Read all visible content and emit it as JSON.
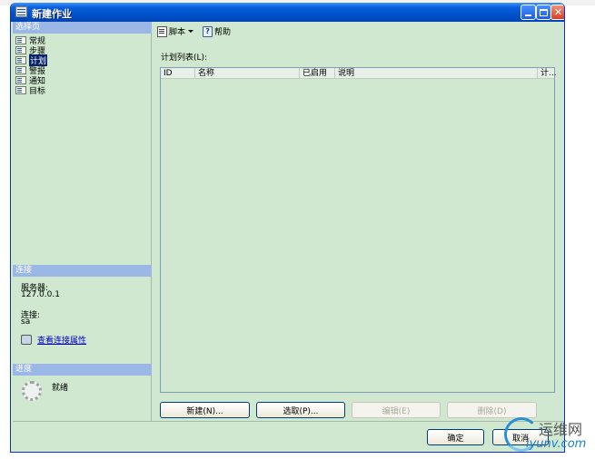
{
  "window": {
    "title": "新建作业"
  },
  "sidebar": {
    "pages_header": "选择页",
    "items": [
      {
        "label": "常规"
      },
      {
        "label": "步骤"
      },
      {
        "label": "计划"
      },
      {
        "label": "警报"
      },
      {
        "label": "通知"
      },
      {
        "label": "目标"
      }
    ],
    "selected_index": 2
  },
  "connection": {
    "header": "连接",
    "server_label": "服务器:",
    "server_value": "127.0.0.1",
    "connection_label": "连接:",
    "connection_value": "sa",
    "view_props_link": "查看连接属性"
  },
  "progress": {
    "header": "进度",
    "status": "就绪"
  },
  "toolbar": {
    "script_label": "脚本",
    "help_label": "帮助"
  },
  "schedule": {
    "list_label": "计划列表(L):",
    "columns": [
      "ID",
      "名称",
      "已启用",
      "说明",
      "计..."
    ],
    "buttons": {
      "new": "新建(N)...",
      "pick": "选取(P)...",
      "edit": "编辑(E)",
      "delete": "删除(D)"
    }
  },
  "footer": {
    "ok": "确定",
    "cancel": "取消"
  },
  "watermark": {
    "title": "运维网",
    "url": "iyunv.com"
  }
}
